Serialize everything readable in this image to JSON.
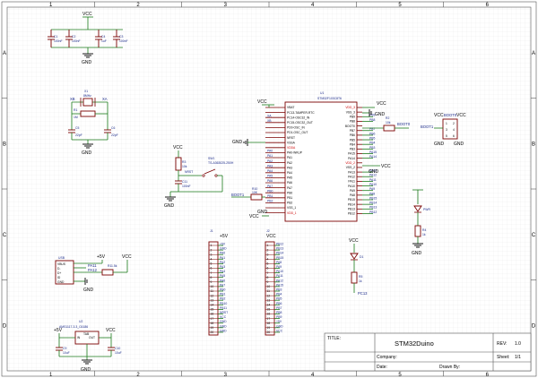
{
  "frame": {
    "cols_top": [
      "1",
      "2",
      "3",
      "4",
      "5",
      "6"
    ],
    "rows_left": [
      "A",
      "B",
      "C",
      "D"
    ]
  },
  "power": {
    "vcc": "VCC",
    "gnd": "GND",
    "plus5v": "+5V"
  },
  "decoupling": {
    "caps": [
      {
        "ref": "C1",
        "val": "100nF"
      },
      {
        "ref": "C2",
        "val": "100nF"
      },
      {
        "ref": "C4",
        "val": "1uF"
      },
      {
        "ref": "C3",
        "val": "100nF"
      }
    ]
  },
  "crystal": {
    "x_in": "XB",
    "x_out": "XA",
    "ref": "X1",
    "freq": "8MHz",
    "r_ref": "R1",
    "r_val": "1M",
    "c5_ref": "C5",
    "c5_val": "22pF",
    "c6_ref": "C6",
    "c6_val": "22pF"
  },
  "reset": {
    "r_ref": "R3",
    "r_val": "10k",
    "sw_ref": "SW1",
    "sw_part": "TS-A363025-250H",
    "net": "NRST",
    "c_ref": "C11",
    "c_val": "100nF",
    "boot_r_ref": "R10",
    "boot_r_val": "10K",
    "boot_net": "BOOT1"
  },
  "mcu": {
    "ref": "U1",
    "part": "STM32F103C8T6",
    "left_pins": [
      "VBAT",
      "PC13-TAMPER-RTC",
      "PC14-OSC32_IN",
      "PC15-OSC32_OUT",
      "PD0-OSC_IN",
      "PD1-OSC_OUT",
      "NRST",
      "VSSA",
      "VDDA",
      "PA0-WKUP",
      "PA1",
      "PA2",
      "PA3",
      "PA4",
      "PA5",
      "PA6",
      "PA7",
      "PB0",
      "PB1",
      "PB2",
      "VSS_1",
      "VDD_1"
    ],
    "left_nets": [
      "",
      "",
      "XA",
      "XB",
      "",
      "",
      "",
      "",
      "",
      "PA0",
      "PA1",
      "PA2",
      "PA3",
      "PA4",
      "PA5",
      "PA6",
      "PA7",
      "PB0",
      "PB1",
      "PB2",
      "",
      ""
    ],
    "right_pins": [
      "VDD_3",
      "VSS_3",
      "PB9",
      "PB8",
      "BOOT0",
      "PB7",
      "PB6",
      "PB5",
      "PB4",
      "PB3",
      "PA15",
      "PA14",
      "VDD_2",
      "VSS_2",
      "PA13",
      "PA12",
      "PA11",
      "PA10",
      "PA9",
      "PA8",
      "PB15",
      "PB14",
      "PB13",
      "PB12"
    ],
    "right_nets": [
      "",
      "",
      "PB9",
      "PB8",
      "",
      "PB7",
      "PB6",
      "PB5",
      "PB4",
      "PB3",
      "PA15",
      "PA14",
      "",
      "",
      "PA13",
      "PA12",
      "PA11",
      "PA10",
      "PA9",
      "PA8",
      "PB15",
      "PB14",
      "PB13",
      "PB12"
    ]
  },
  "boot": {
    "r_ref": "R2",
    "r_val": "10k",
    "net0": "BOOT0",
    "net1": "BOOT1",
    "header_pins": [
      "1",
      "2",
      "3",
      "4",
      "5",
      "6"
    ]
  },
  "power_led": {
    "led_ref": "PWR",
    "r_ref": "R4",
    "r_val": "1k"
  },
  "user_led": {
    "led_ref": "D1",
    "r_ref": "R5",
    "r_val": "1k",
    "net": "PC13"
  },
  "usb": {
    "ref": "USB",
    "pins": [
      "VBUS",
      "D-",
      "D+",
      "ID",
      "GND"
    ],
    "nets": [
      "PA11",
      "PA12"
    ],
    "r_ref": "R1",
    "r_val": "1.5k"
  },
  "regulator": {
    "ref": "U2",
    "part": "AMS1117-3.3_C6186",
    "pin_in": "IN",
    "pin_out": "OUT",
    "pin_tab": "TAB",
    "c_in_ref": "C9",
    "c_in_val": "10uF",
    "c_out_ref": "C10",
    "c_out_val": "10uF"
  },
  "header_j1": {
    "ref": "J1",
    "rows": [
      "1",
      "2",
      "3",
      "4",
      "5",
      "6",
      "7",
      "8",
      "9",
      "10",
      "11",
      "12",
      "13",
      "14",
      "15",
      "16",
      "17",
      "18",
      "19",
      "20"
    ],
    "nets": [
      "+5V",
      "GND",
      "PA0",
      "PA1",
      "PA2",
      "PA3",
      "PA4",
      "PA5",
      "PA6",
      "PA7",
      "PB0",
      "PB1",
      "PB2",
      "PB10",
      "PB11",
      "NRST",
      "VCC",
      "GND",
      "GND",
      "GND"
    ]
  },
  "header_j2": {
    "ref": "J2",
    "rows": [
      "1",
      "2",
      "3",
      "4",
      "5",
      "6",
      "7",
      "8",
      "9",
      "10",
      "11",
      "12",
      "13",
      "14",
      "15",
      "16",
      "17",
      "18",
      "19",
      "20"
    ],
    "nets": [
      "PB12",
      "PB13",
      "PB14",
      "PB15",
      "PA8",
      "PA9",
      "PA10",
      "PA11",
      "PA12",
      "PA15",
      "PB3",
      "PB4",
      "PB5",
      "PB6",
      "PB7",
      "PB8",
      "PB9",
      "+5V",
      "GND",
      "VCC"
    ]
  },
  "title_block": {
    "title_label": "TITLE:",
    "title": "STM32Duino",
    "rev_label": "REV:",
    "rev": "1.0",
    "company_label": "Company:",
    "sheet_label": "Sheet:",
    "sheet": "1/1",
    "date_label": "Date:",
    "drawn_label": "Drawn By:"
  }
}
